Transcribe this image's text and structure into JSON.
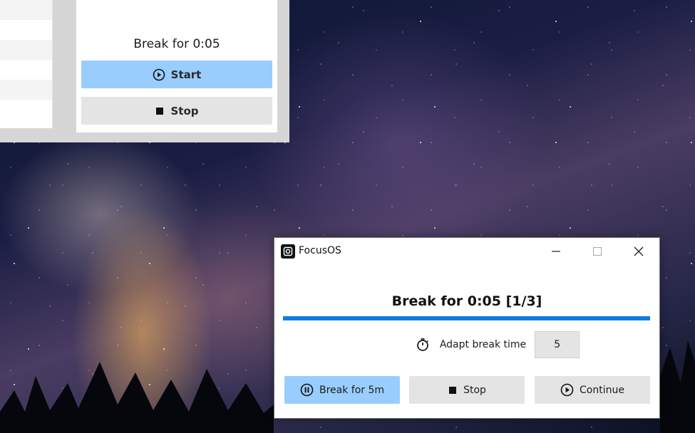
{
  "background_app": {
    "status_text": "Break for 0:05",
    "start_label": "Start",
    "stop_label": "Stop"
  },
  "window": {
    "title": "FocusOS",
    "controls": [
      "minimize",
      "maximize",
      "close"
    ]
  },
  "main": {
    "heading": "Break for 0:05 [1/3]",
    "progress_fraction": 1.0,
    "adapt_label": "Adapt break time",
    "adapt_value": "5"
  },
  "actions": {
    "break_label": "Break for 5m",
    "stop_label": "Stop",
    "continue_label": "Continue"
  },
  "colors": {
    "primary_button": "#99cdfe",
    "secondary_button": "#e4e4e4",
    "progress": "#0f7ddf"
  },
  "icons": {
    "start": "play-circle-icon",
    "stop": "stop-square-icon",
    "break": "pause-circle-icon",
    "continue": "play-circle-icon",
    "adapt": "stopwatch-icon",
    "app": "focusos-app-icon"
  }
}
